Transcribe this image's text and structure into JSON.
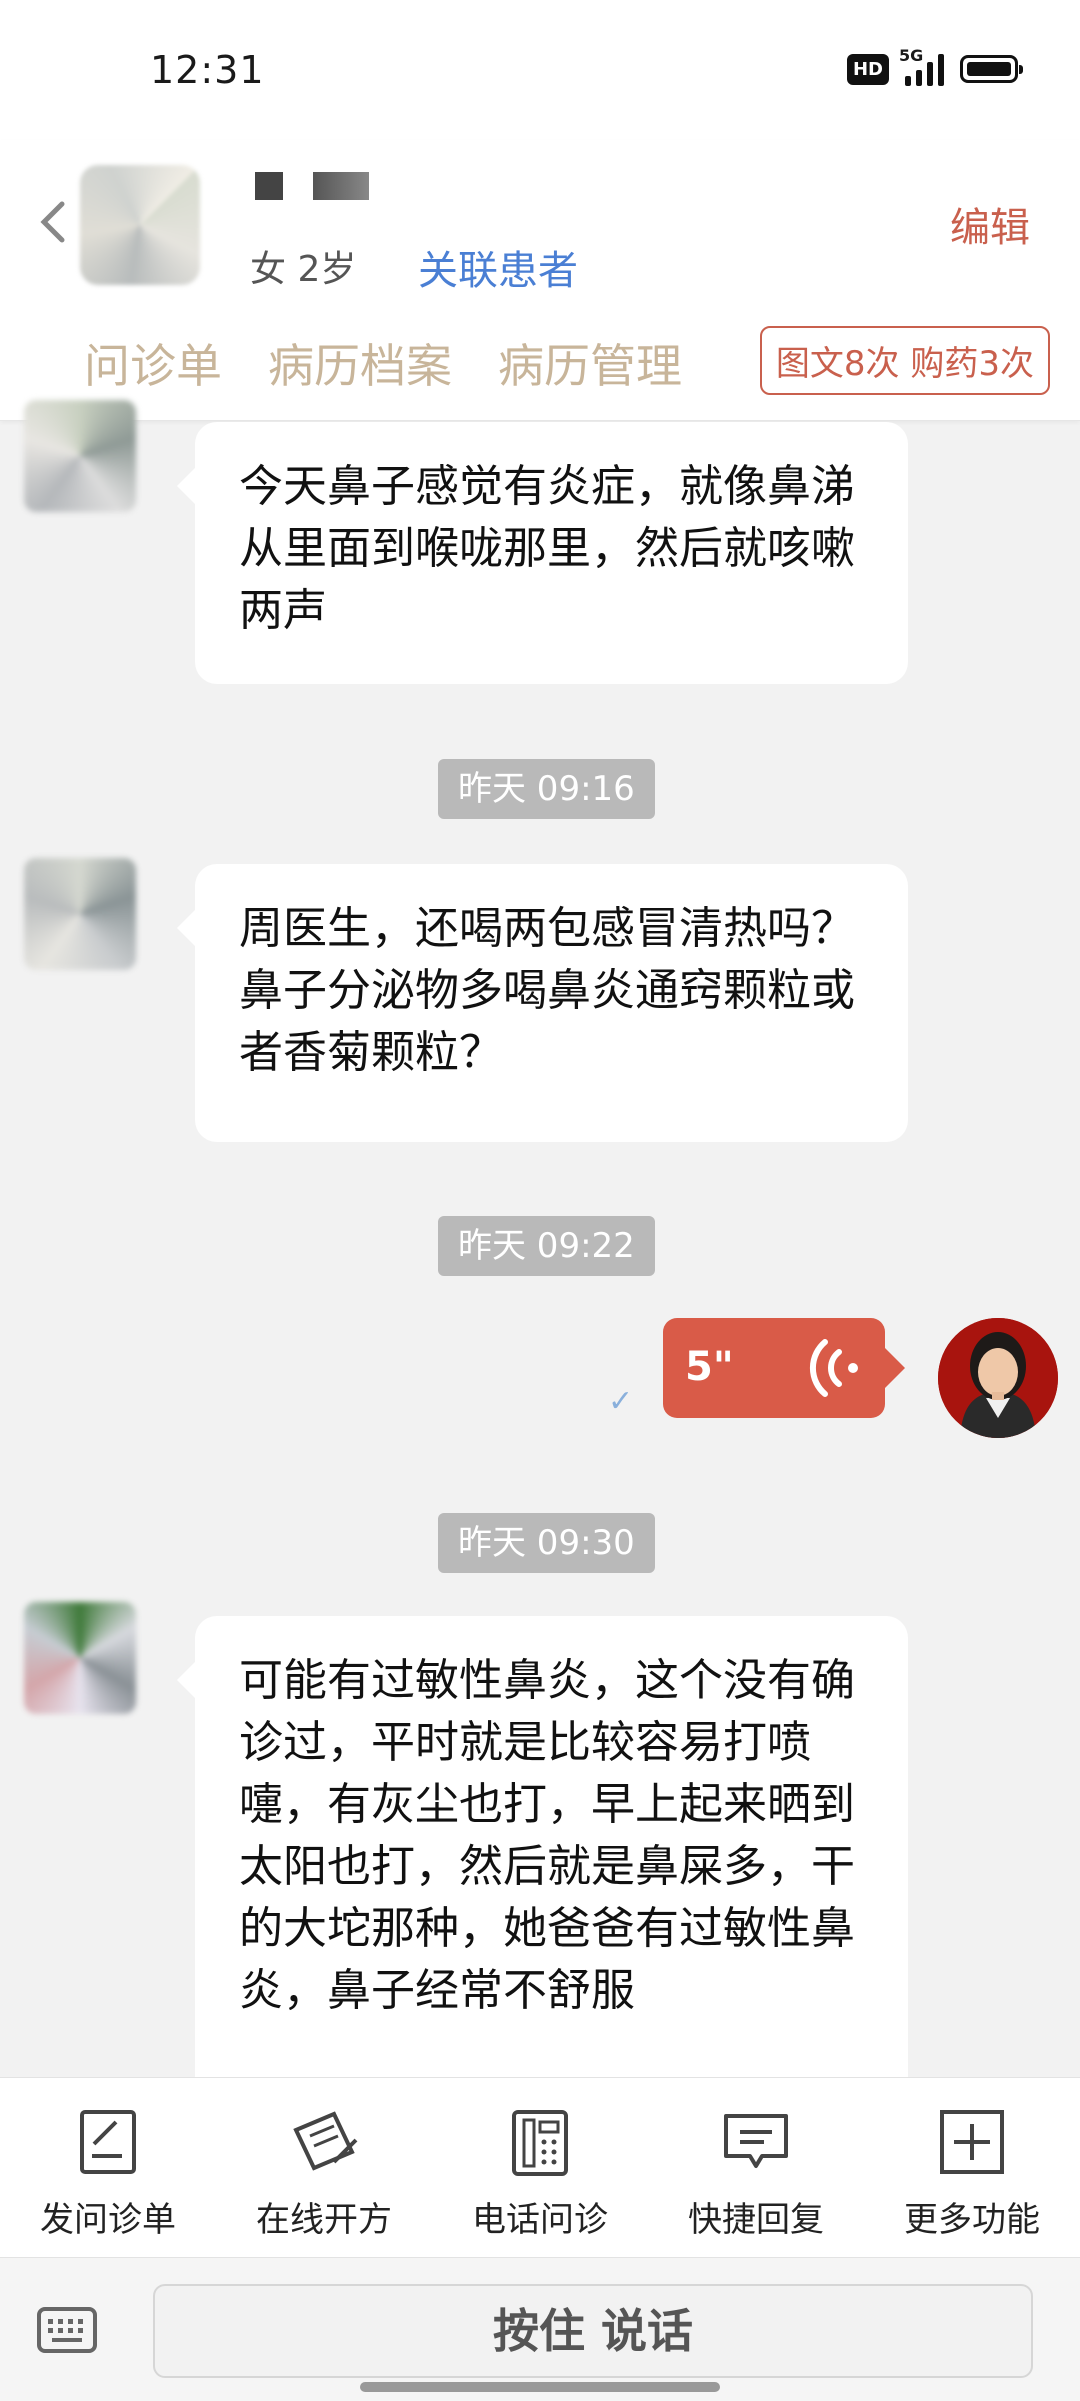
{
  "status": {
    "time": "12:31",
    "hd": "HD",
    "network": "5G"
  },
  "header": {
    "patient_info": "女 2岁",
    "link_patient": "关联患者",
    "edit": "编辑",
    "tabs": [
      "问诊单",
      "病历档案",
      "病历管理"
    ],
    "counts": "图文8次 购药3次"
  },
  "messages": [
    {
      "text": "今天鼻子感觉有炎症，就像鼻涕从里面到喉咙那里，然后就咳嗽两声"
    },
    {
      "timestamp": "昨天 09:16",
      "text": "周医生，还喝两包感冒清热吗？鼻子分泌物多喝鼻炎通窍颗粒或者香菊颗粒？"
    },
    {
      "timestamp": "昨天 09:22",
      "voice_duration": "5\""
    },
    {
      "timestamp": "昨天 09:30",
      "text": "可能有过敏性鼻炎，这个没有确诊过，平时就是比较容易打喷嚏，有灰尘也打，早上起来晒到太阳也打，然后就是鼻屎多，干的大坨那种，她爸爸有过敏性鼻炎，鼻子经常不舒服"
    }
  ],
  "toolbar": {
    "items": [
      {
        "label": "发问诊单",
        "icon": "form-icon"
      },
      {
        "label": "在线开方",
        "icon": "prescription-icon"
      },
      {
        "label": "电话问诊",
        "icon": "phone-icon"
      },
      {
        "label": "快捷回复",
        "icon": "quick-reply-icon"
      },
      {
        "label": "更多功能",
        "icon": "plus-icon"
      }
    ]
  },
  "input": {
    "hold_to_talk": "按住 说话"
  }
}
